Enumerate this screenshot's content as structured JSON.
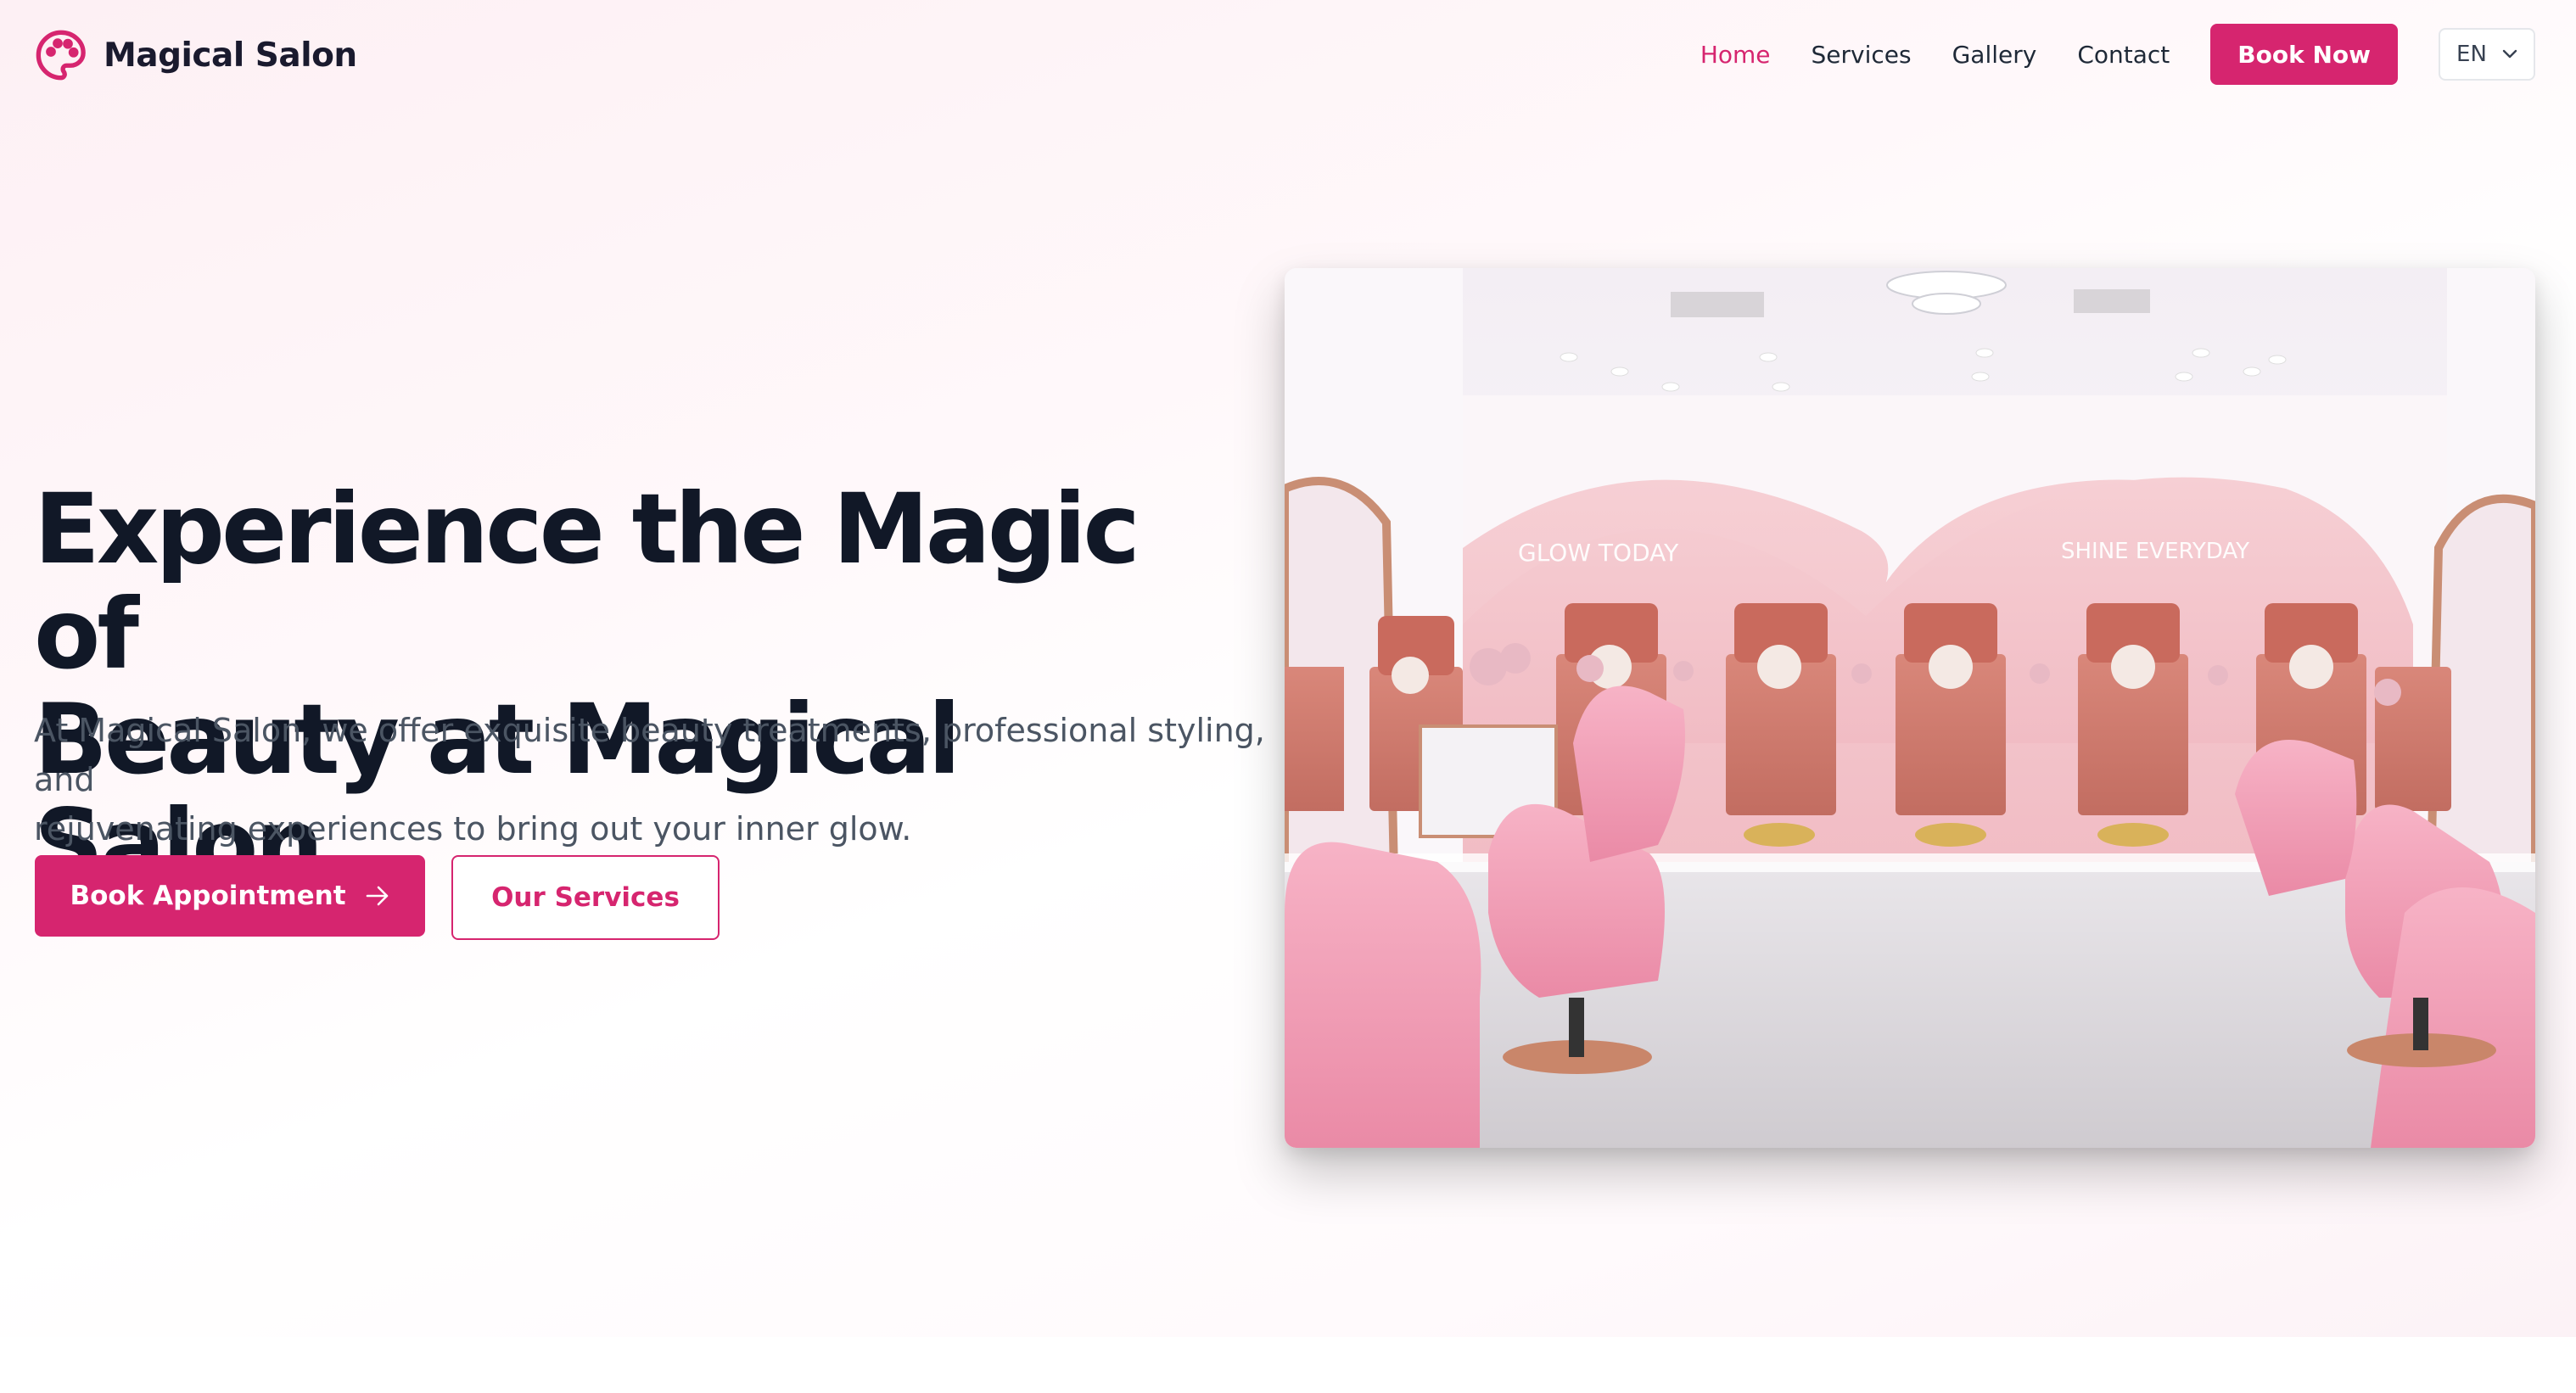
{
  "brand": {
    "name": "Magical Salon",
    "icon": "palette-icon",
    "color": "#d6256f"
  },
  "nav": {
    "items": [
      {
        "label": "Home",
        "active": true
      },
      {
        "label": "Services",
        "active": false
      },
      {
        "label": "Gallery",
        "active": false
      },
      {
        "label": "Contact",
        "active": false
      }
    ],
    "cta_label": "Book Now",
    "language": "EN"
  },
  "hero": {
    "title_line1": "Experience the Magic of",
    "title_line2": "Beauty at Magical Salon",
    "subtitle_line1": "At Magical Salon, we offer exquisite beauty treatments, professional styling, and",
    "subtitle_line2": "rejuvenating experiences to bring out your inner glow.",
    "primary_button": "Book Appointment",
    "secondary_button": "Our Services",
    "image": {
      "neon_left": "GLOW TODAY",
      "neon_right": "SHINE EVERYDAY"
    }
  },
  "colors": {
    "accent": "#d6256f",
    "heading": "#111827",
    "body_text": "#4b5563"
  }
}
